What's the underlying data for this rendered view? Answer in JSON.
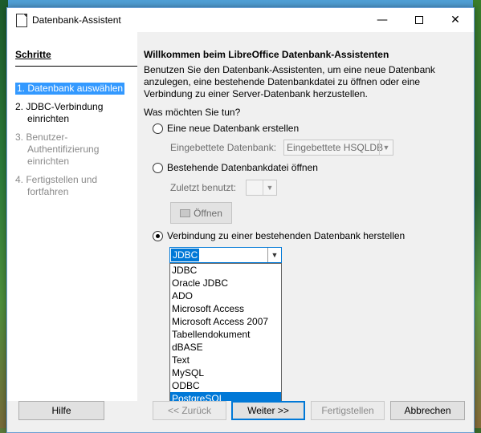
{
  "window": {
    "title": "Datenbank-Assistent",
    "minimize": "—",
    "close": "✕"
  },
  "sidebar": {
    "title": "Schritte",
    "steps": [
      {
        "label": "1. Datenbank auswählen"
      },
      {
        "label": "2. JDBC-Verbindung",
        "label2": "einrichten"
      },
      {
        "label": "3. Benutzer-",
        "label2": "Authentifizierung",
        "label3": "einrichten"
      },
      {
        "label": "4. Fertigstellen und",
        "label2": "fortfahren"
      }
    ]
  },
  "main": {
    "heading": "Willkommen beim LibreOffice Datenbank-Assistenten",
    "intro": "Benutzen Sie den Datenbank-Assistenten, um eine neue Datenbank anzulegen, eine bestehende Datenbankdatei zu öffnen oder eine Verbindung zu einer Server-Datenbank herzustellen.",
    "question": "Was möchten Sie tun?",
    "option_new": "Eine neue Datenbank erstellen",
    "embedded_label": "Eingebettete Datenbank:",
    "embedded_value": "Eingebettete HSQLDB",
    "option_open": "Bestehende Datenbankdatei öffnen",
    "recent_label": "Zuletzt benutzt:",
    "recent_value": "",
    "open_button": "Öffnen",
    "option_connect": "Verbindung zu einer bestehenden Datenbank herstellen",
    "selected_option": "connect",
    "connection_type": "JDBC",
    "connection_types": [
      "JDBC",
      "Oracle JDBC",
      "ADO",
      "Microsoft Access",
      "Microsoft Access 2007",
      "Tabellendokument",
      "dBASE",
      "Text",
      "MySQL",
      "ODBC",
      "PostgreSQL"
    ],
    "highlighted_type": "PostgreSQL"
  },
  "buttons": {
    "help": "Hilfe",
    "back": "<< Zurück",
    "next": "Weiter >>",
    "finish": "Fertigstellen",
    "cancel": "Abbrechen"
  },
  "colors": {
    "accent": "#0078d7",
    "step_highlight": "#3399ff"
  }
}
